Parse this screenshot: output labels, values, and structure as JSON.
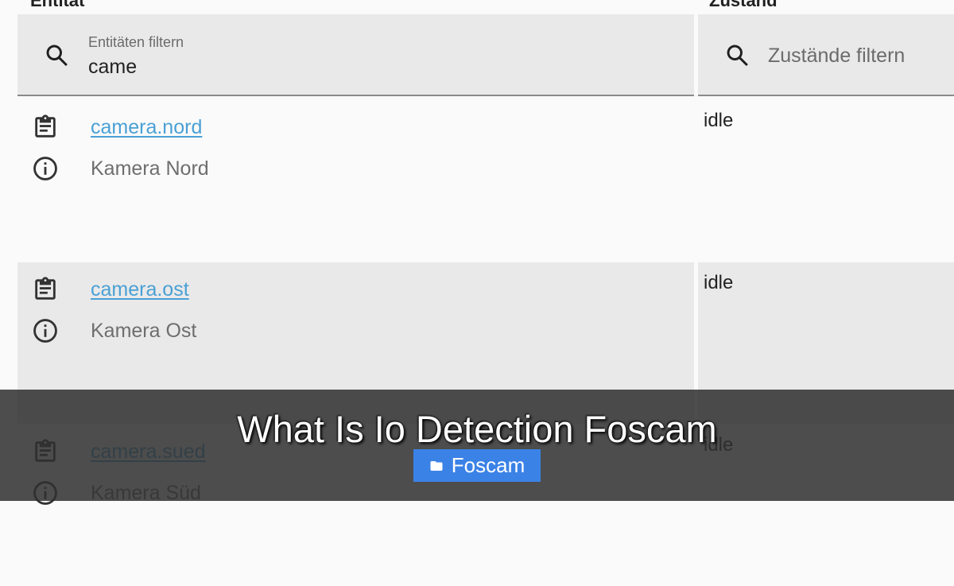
{
  "table": {
    "headers": {
      "entity": "Entität",
      "state": "Zustand"
    },
    "entity_filter": {
      "label": "Entitäten filtern",
      "value": "came"
    },
    "state_filter": {
      "placeholder": "Zustände filtern"
    },
    "rows": [
      {
        "entity_id": "camera.nord",
        "friendly_name": "Kamera Nord",
        "state": "idle"
      },
      {
        "entity_id": "camera.ost",
        "friendly_name": "Kamera Ost",
        "state": "idle"
      },
      {
        "entity_id": "camera.sued",
        "friendly_name": "Kamera Süd",
        "state": "idle"
      }
    ]
  },
  "overlay": {
    "title": "What Is Io Detection Foscam",
    "tag_label": "Foscam",
    "tag_icon": "folder-icon",
    "tag_color": "#3b82e6"
  },
  "colors": {
    "link": "#4aa0d5",
    "row_alt": "#e9e9e9",
    "background": "#fafafa"
  }
}
